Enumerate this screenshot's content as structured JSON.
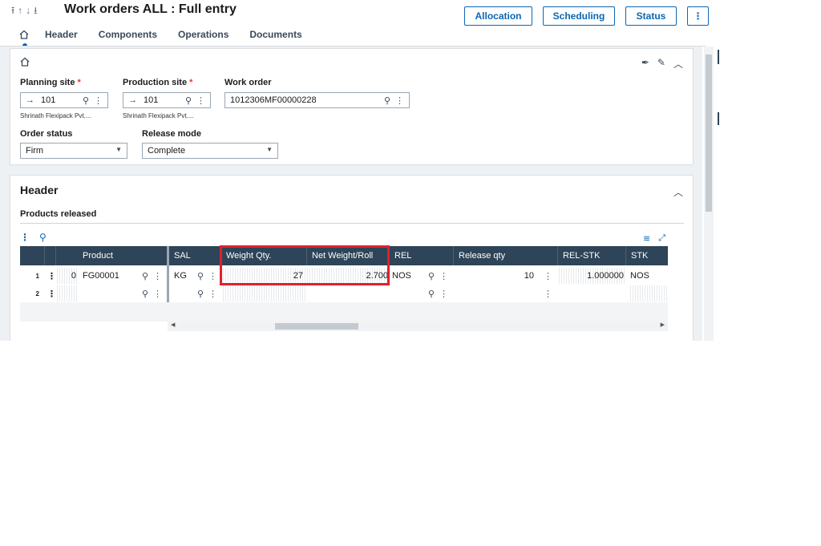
{
  "header": {
    "title": "Work orders ALL : Full entry",
    "nav": [
      "⭱",
      "↑",
      "↓",
      "⭳"
    ],
    "buttons": {
      "allocation": "Allocation",
      "scheduling": "Scheduling",
      "status": "Status",
      "more": "⋮"
    }
  },
  "tabs": [
    "Header",
    "Components",
    "Operations",
    "Documents"
  ],
  "form": {
    "planning_site": {
      "label": "Planning site",
      "value": "101",
      "desc": "Shrinath Flexipack Pvt...."
    },
    "production_site": {
      "label": "Production site",
      "value": "101",
      "desc": "Shrinath Flexipack Pvt...."
    },
    "work_order": {
      "label": "Work order",
      "value": "1012306MF00000228"
    },
    "order_status": {
      "label": "Order status",
      "value": "Firm"
    },
    "release_mode": {
      "label": "Release mode",
      "value": "Complete"
    },
    "required_mark": "*"
  },
  "section": {
    "title": "Header",
    "subtitle": "Products released"
  },
  "grid": {
    "columns": [
      "Product",
      "SAL",
      "Weight Qty.",
      "Net Weight/Roll",
      "REL",
      "Release qty",
      "REL-STK",
      "STK"
    ],
    "rows": [
      {
        "num": "1",
        "zero": "0",
        "product": "FG00001",
        "sal": "KG",
        "weight_qty": "27",
        "net_weight": "2.700",
        "rel": "NOS",
        "release_qty": "10",
        "rel_stk": "1.000000",
        "stk": "NOS"
      },
      {
        "num": "2",
        "zero": "",
        "product": "",
        "sal": "",
        "weight_qty": "",
        "net_weight": "",
        "rel": "",
        "release_qty": "",
        "rel_stk": "",
        "stk": ""
      }
    ]
  },
  "colors": {
    "accent": "#0c66b3",
    "grid_header": "#2e4458",
    "highlight": "#e0202b",
    "required": "#e23d3d"
  },
  "icons": [
    "home-icon",
    "search-icon",
    "kebab-icon",
    "pin-icon",
    "edit-icon",
    "collapse-icon",
    "layers-icon",
    "expand-icon"
  ]
}
